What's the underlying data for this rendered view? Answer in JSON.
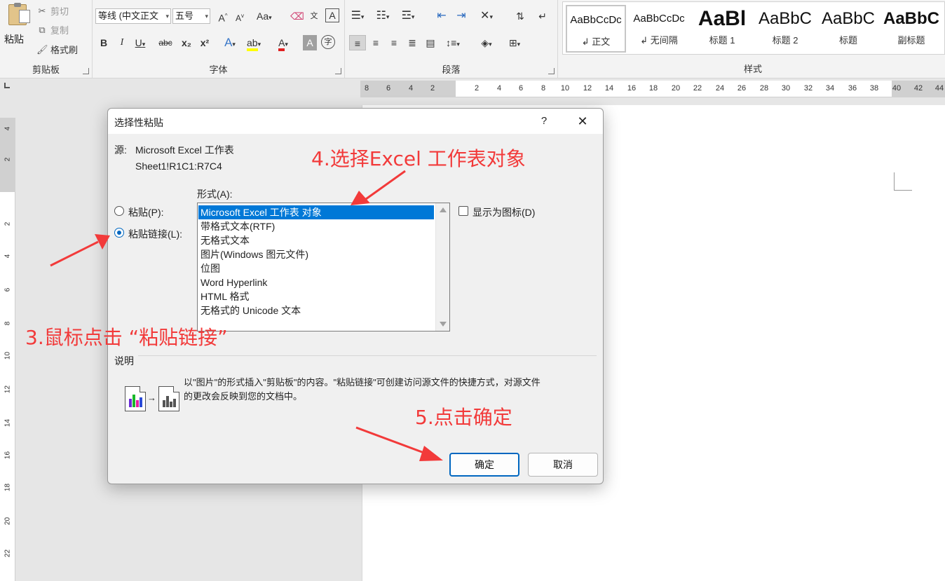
{
  "ribbon": {
    "clipboard": {
      "paste_label": "粘贴",
      "cut_label": "剪切",
      "copy_label": "复制",
      "format_painter_label": "格式刷",
      "group_label": "剪贴板"
    },
    "font": {
      "font_name": "等线 (中文正文",
      "font_size": "五号",
      "grow_glyph": "A",
      "shrink_glyph": "A",
      "case_label": "Aa",
      "bold": "B",
      "italic": "I",
      "underline": "U",
      "strike": "abc",
      "subscript": "x₂",
      "superscript": "x²",
      "effects_glyph": "A",
      "highlight_glyph": "ab",
      "font_color_glyph": "A",
      "shading_glyph": "A",
      "enclose_glyph": "字",
      "group_label": "字体"
    },
    "paragraph": {
      "group_label": "段落"
    },
    "styles": {
      "items": [
        {
          "sample": "AaBbCcDc",
          "name": "↲ 正文"
        },
        {
          "sample": "AaBbCcDc",
          "name": "↲ 无间隔"
        },
        {
          "sample": "AaBl",
          "name": "标题 1"
        },
        {
          "sample": "AaBbC",
          "name": "标题 2"
        },
        {
          "sample": "AaBbC",
          "name": "标题"
        },
        {
          "sample": "AaBbC",
          "name": "副标题"
        }
      ],
      "group_label": "样式"
    }
  },
  "ruler": {
    "h_ticks": [
      "8",
      "6",
      "4",
      "2",
      "2",
      "4",
      "6",
      "8",
      "10",
      "12",
      "14",
      "16",
      "18",
      "20",
      "22",
      "24",
      "26",
      "28",
      "30",
      "32",
      "34",
      "36",
      "38",
      "40",
      "42",
      "44"
    ],
    "v_ticks": [
      "4",
      "2",
      "2",
      "4",
      "6",
      "8",
      "10",
      "12",
      "14",
      "16",
      "18",
      "20",
      "22"
    ]
  },
  "dialog": {
    "title": "选择性粘贴",
    "help": "?",
    "close": "✕",
    "source_label": "源:",
    "source_name": "Microsoft Excel 工作表",
    "source_range": "Sheet1!R1C1:R7C4",
    "as_label": "形式(A):",
    "paste_radio": "粘贴(P):",
    "paste_link_radio": "粘贴链接(L):",
    "formats": [
      "Microsoft Excel 工作表 对象",
      "带格式文本(RTF)",
      "无格式文本",
      "图片(Windows 图元文件)",
      "位图",
      "Word Hyperlink",
      "HTML 格式",
      "无格式的 Unicode 文本"
    ],
    "selected_format_index": 0,
    "display_as_icon": "显示为图标(D)",
    "result_label": "说明",
    "result_text_line1": "以\"图片\"的形式插入\"剪贴板\"的内容。\"粘贴链接\"可创建访问源文件的快捷方式，对源文件",
    "result_text_line2": "的更改会反映到您的文档中。",
    "ok": "确定",
    "cancel": "取消"
  },
  "annotations": {
    "step3": "3.鼠标点击 “粘贴链接”",
    "step4": "4.选择Excel 工作表对象",
    "step5": "5.点击确定",
    "color": "#f23a3a"
  }
}
